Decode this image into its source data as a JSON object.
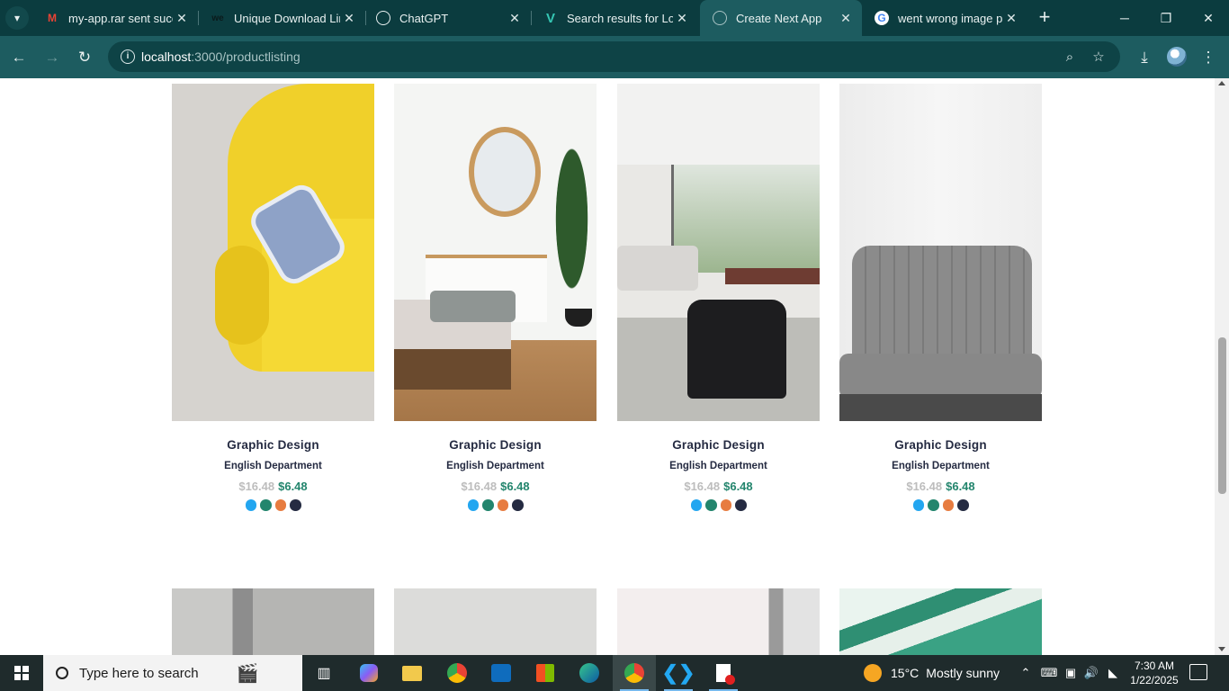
{
  "browser": {
    "tabs": [
      {
        "title": "my-app.rar sent successfully",
        "favicon": "gmail-icon"
      },
      {
        "title": "Unique Download Link",
        "favicon": "wetransfer-icon"
      },
      {
        "title": "ChatGPT",
        "favicon": "chatgpt-icon"
      },
      {
        "title": "Search results for Logo",
        "favicon": "vecteezy-icon"
      },
      {
        "title": "Create Next App",
        "favicon": "globe-icon",
        "active": true
      },
      {
        "title": "went wrong image preview",
        "favicon": "google-icon"
      }
    ],
    "url_host": "localhost",
    "url_path": ":3000/productlisting"
  },
  "products": [
    {
      "name": "Graphic Design",
      "department": "English Department",
      "old_price": "$16.48",
      "price": "$6.48",
      "image": "yellow-armchair"
    },
    {
      "name": "Graphic Design",
      "department": "English Department",
      "old_price": "$16.48",
      "price": "$6.48",
      "image": "bedroom-mirror"
    },
    {
      "name": "Graphic Design",
      "department": "English Department",
      "old_price": "$16.48",
      "price": "$6.48",
      "image": "living-room-black-chair"
    },
    {
      "name": "Graphic Design",
      "department": "English Department",
      "old_price": "$16.48",
      "price": "$6.48",
      "image": "grey-sofa"
    }
  ],
  "swatch_colors": [
    "#23a6f0",
    "#23856d",
    "#e77c40",
    "#252b42"
  ],
  "taskbar": {
    "search_placeholder": "Type here to search",
    "weather_temp": "15°C",
    "weather_text": "Mostly sunny",
    "time": "7:30 AM",
    "date": "1/22/2025"
  }
}
